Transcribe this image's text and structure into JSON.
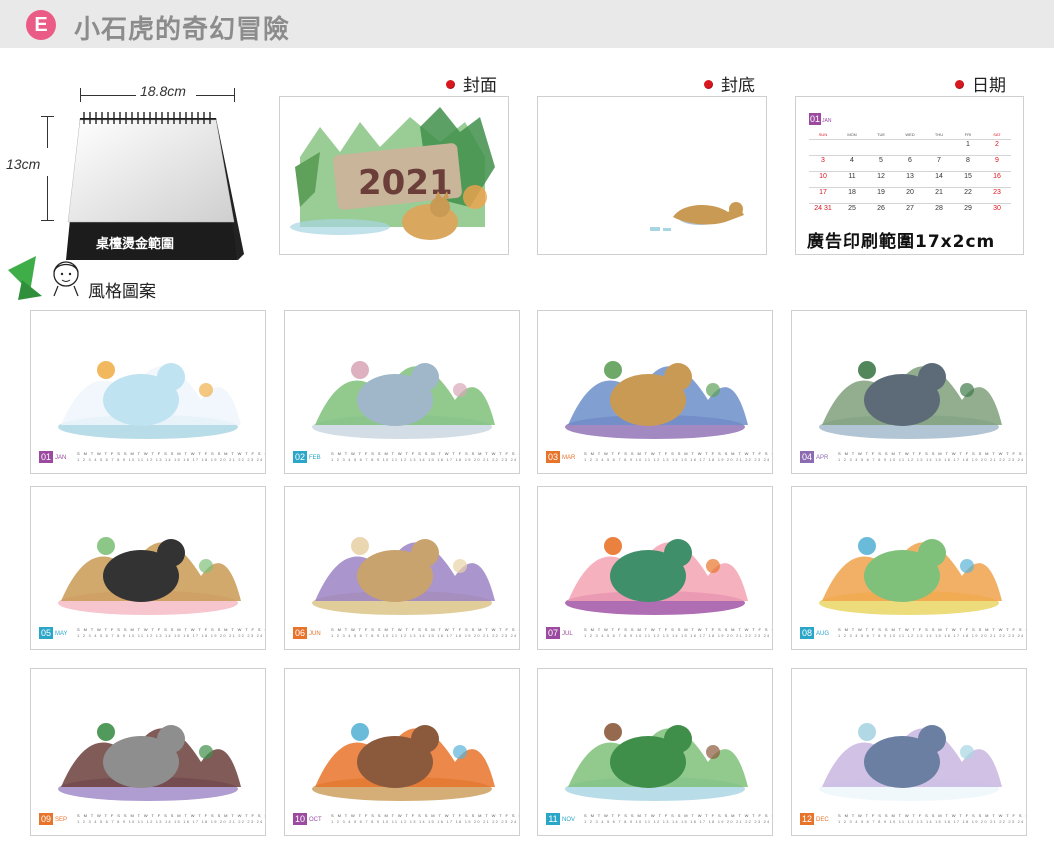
{
  "header": {
    "badge": "E",
    "title": "小石虎的奇幻冒險"
  },
  "product": {
    "width_label": "18.8cm",
    "height_label": "13cm",
    "stamp_area_label": "桌檯燙金範圍"
  },
  "samples": {
    "cover_label": "封面",
    "back_label": "封底",
    "date_label": "日期",
    "cover_year": "2021",
    "mini_month_num": "01",
    "mini_month_name": "JAN",
    "weekdays": [
      "SUN",
      "MON",
      "TUE",
      "WED",
      "THU",
      "FRI",
      "SAT"
    ],
    "weeks": [
      [
        "",
        "",
        "",
        "",
        "",
        "1",
        "2"
      ],
      [
        "3",
        "4",
        "5",
        "6",
        "7",
        "8",
        "9"
      ],
      [
        "10",
        "11",
        "12",
        "13",
        "14",
        "15",
        "16"
      ],
      [
        "17",
        "18",
        "19",
        "20",
        "21",
        "22",
        "23"
      ],
      [
        "24 31",
        "25",
        "26",
        "27",
        "28",
        "29",
        "30"
      ]
    ],
    "ad_area_text": "廣告印刷範圍17x2cm"
  },
  "style_section": {
    "title": "風格圖案"
  },
  "months": [
    {
      "num": "01",
      "name": "JAN",
      "color": "#9b4aa0",
      "theme": "polar-bear"
    },
    {
      "num": "02",
      "name": "FEB",
      "color": "#2aa6c9",
      "theme": "city"
    },
    {
      "num": "03",
      "name": "MAR",
      "color": "#e8732a",
      "theme": "cat-scarf"
    },
    {
      "num": "04",
      "name": "APR",
      "color": "#8c6bb1",
      "theme": "factory"
    },
    {
      "num": "05",
      "name": "MAY",
      "color": "#2aa6c9",
      "theme": "black-bear"
    },
    {
      "num": "06",
      "name": "JUN",
      "color": "#e8732a",
      "theme": "desert"
    },
    {
      "num": "07",
      "name": "JUL",
      "color": "#9b4aa0",
      "theme": "turtle"
    },
    {
      "num": "08",
      "name": "AUG",
      "color": "#2aa6c9",
      "theme": "waterfall"
    },
    {
      "num": "09",
      "name": "SEP",
      "color": "#e8732a",
      "theme": "koala"
    },
    {
      "num": "10",
      "name": "OCT",
      "color": "#9b4aa0",
      "theme": "crab"
    },
    {
      "num": "11",
      "name": "NOV",
      "color": "#2aa6c9",
      "theme": "forest"
    },
    {
      "num": "12",
      "name": "DEC",
      "color": "#e8732a",
      "theme": "penguin"
    }
  ],
  "weekday_strip": "S M T W T F S S M T W T F S S M T W T F S S M T W T F S S M T W",
  "date_strip": "1 2 3 4 5 6 7 8 9 10 11 12 13 14 15 16 17 18 19 20 21 22 23 24 25 26 27 28 29 30 31"
}
